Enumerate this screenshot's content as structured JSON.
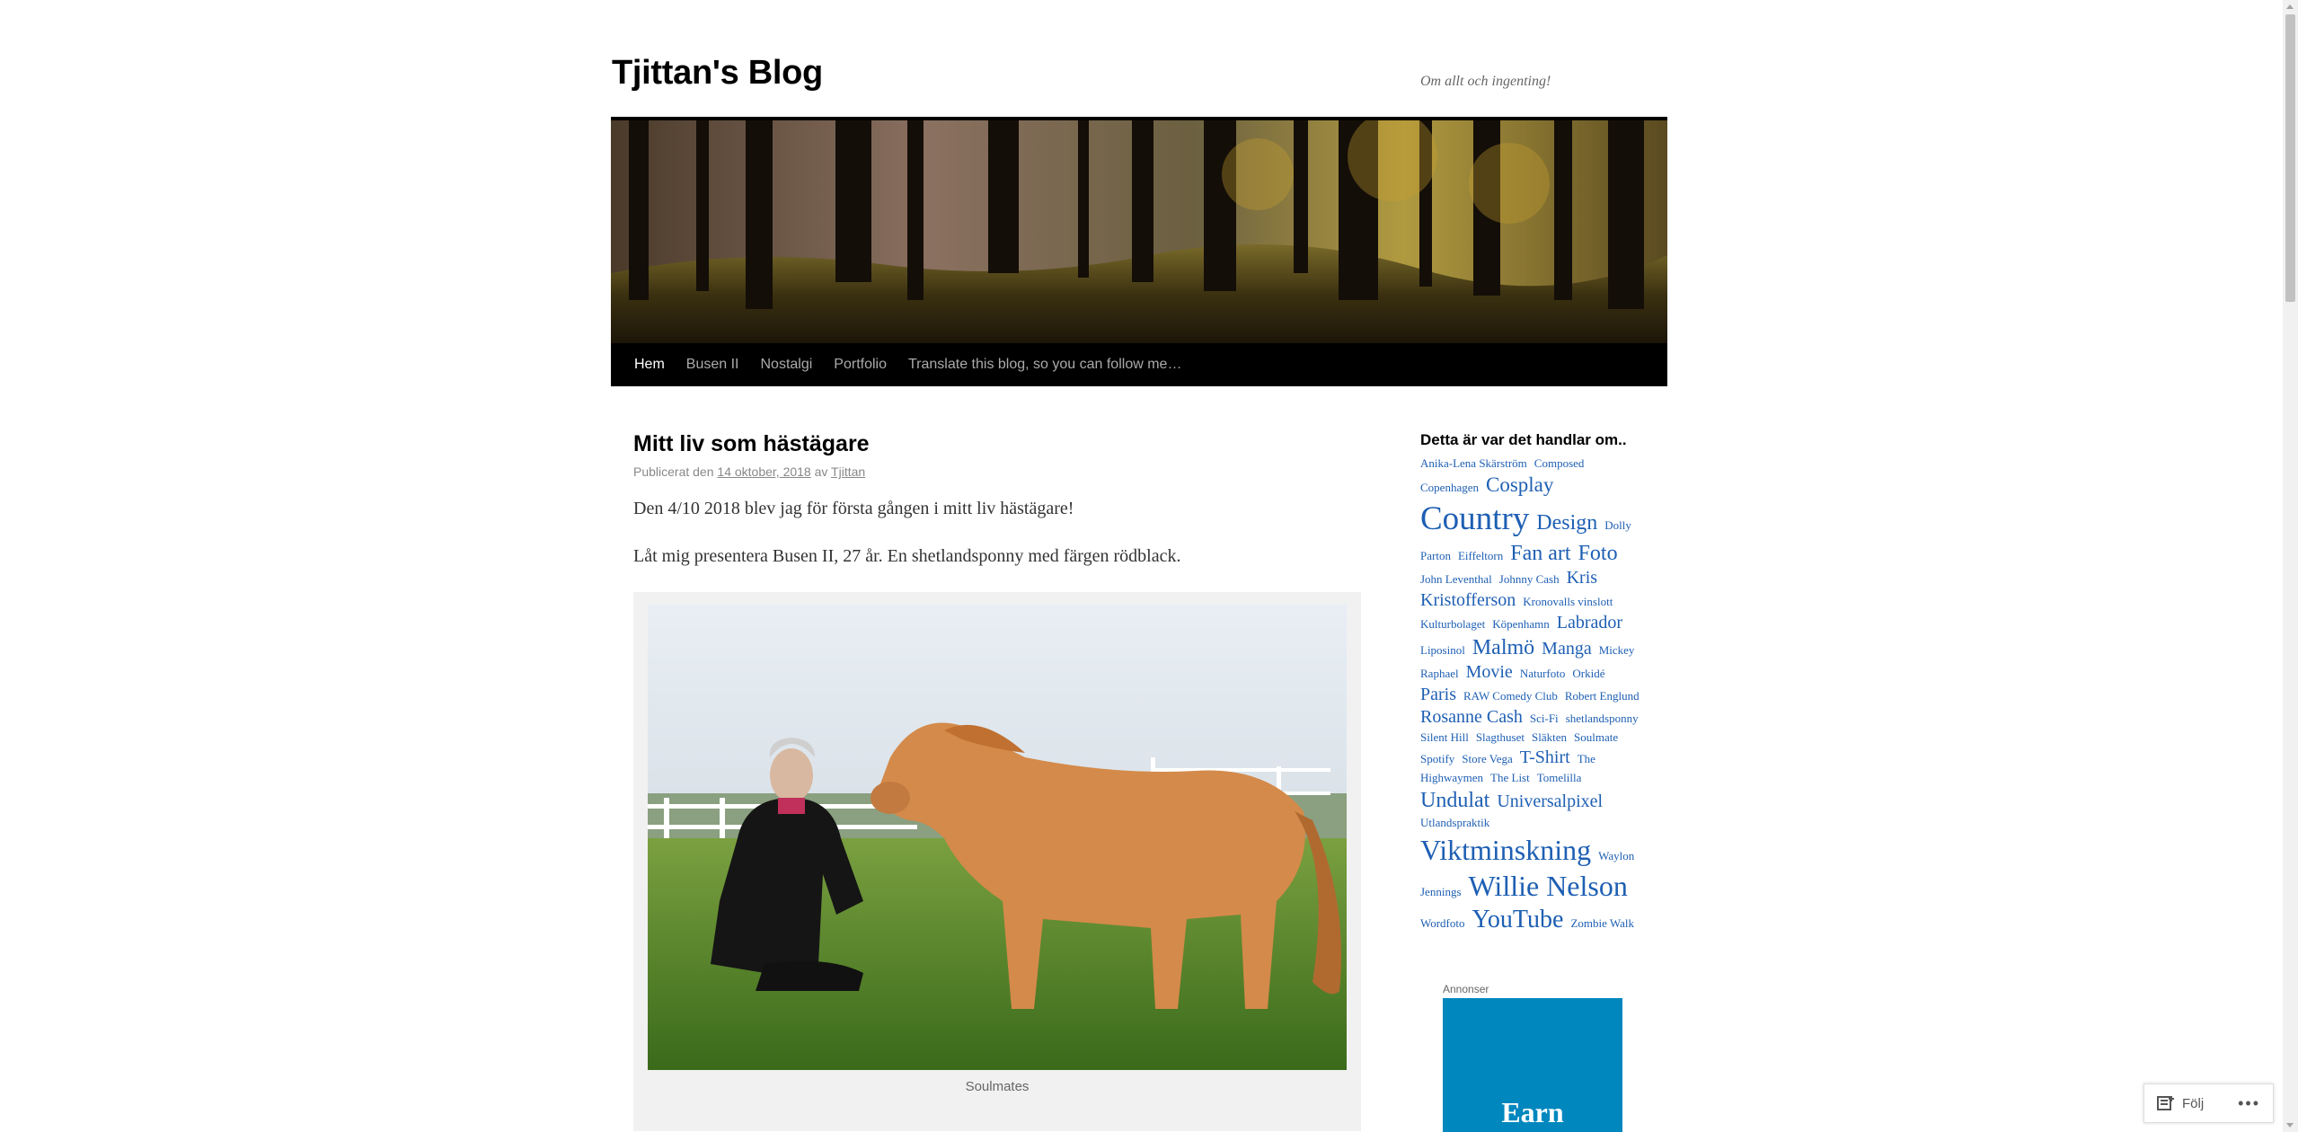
{
  "site": {
    "title": "Tjittan's Blog",
    "description": "Om allt och ingenting!"
  },
  "nav": {
    "items": [
      {
        "label": "Hem",
        "current": true
      },
      {
        "label": "Busen II"
      },
      {
        "label": "Nostalgi"
      },
      {
        "label": "Portfolio"
      },
      {
        "label": "Translate this blog, so you can follow me…"
      }
    ]
  },
  "post": {
    "title": "Mitt liv som hästägare",
    "meta_prefix": "Publicerat den",
    "date": "14 oktober, 2018",
    "meta_by": "av",
    "author": "Tjittan",
    "paragraphs": [
      "Den 4/10 2018 blev jag för första gången i mitt liv hästägare!",
      "Låt mig presentera Busen II, 27 år. En shetlandsponny med färgen rödblack."
    ],
    "image_caption": "Soulmates"
  },
  "sidebar": {
    "widget_title": "Detta är var det handlar om..",
    "tags": [
      {
        "label": "Anika-Lena Skärström",
        "size": 13
      },
      {
        "label": "Composed",
        "size": 13
      },
      {
        "label": "Copenhagen",
        "size": 13
      },
      {
        "label": "Cosplay",
        "size": 23
      },
      {
        "label": "Country",
        "size": 37
      },
      {
        "label": "Design",
        "size": 24
      },
      {
        "label": "Dolly Parton",
        "size": 13
      },
      {
        "label": "Eiffeltorn",
        "size": 13
      },
      {
        "label": "Fan art",
        "size": 24
      },
      {
        "label": "Foto",
        "size": 24
      },
      {
        "label": "John Leventhal",
        "size": 13
      },
      {
        "label": "Johnny Cash",
        "size": 13
      },
      {
        "label": "Kris Kristofferson",
        "size": 20
      },
      {
        "label": "Kronovalls vinslott",
        "size": 13
      },
      {
        "label": "Kulturbolaget",
        "size": 13
      },
      {
        "label": "Köpenhamn",
        "size": 13
      },
      {
        "label": "Labrador",
        "size": 20
      },
      {
        "label": "Liposinol",
        "size": 13
      },
      {
        "label": "Malmö",
        "size": 24
      },
      {
        "label": "Manga",
        "size": 20
      },
      {
        "label": "Mickey Raphael",
        "size": 13
      },
      {
        "label": "Movie",
        "size": 20
      },
      {
        "label": "Naturfoto",
        "size": 13
      },
      {
        "label": "Orkidé",
        "size": 13
      },
      {
        "label": "Paris",
        "size": 20
      },
      {
        "label": "RAW Comedy Club",
        "size": 13
      },
      {
        "label": "Robert Englund",
        "size": 13
      },
      {
        "label": "Rosanne Cash",
        "size": 20
      },
      {
        "label": "Sci-Fi",
        "size": 13
      },
      {
        "label": "shetlandsponny",
        "size": 13
      },
      {
        "label": "Silent Hill",
        "size": 13
      },
      {
        "label": "Slagthuset",
        "size": 13
      },
      {
        "label": "Släkten",
        "size": 13
      },
      {
        "label": "Soulmate",
        "size": 13
      },
      {
        "label": "Spotify",
        "size": 13
      },
      {
        "label": "Store Vega",
        "size": 13
      },
      {
        "label": "T-Shirt",
        "size": 20
      },
      {
        "label": "The Highwaymen",
        "size": 13
      },
      {
        "label": "The List",
        "size": 13
      },
      {
        "label": "Tomelilla",
        "size": 13
      },
      {
        "label": "Undulat",
        "size": 24
      },
      {
        "label": "Universalpixel",
        "size": 20
      },
      {
        "label": "Utlandspraktik",
        "size": 13
      },
      {
        "label": "Viktminskning",
        "size": 32
      },
      {
        "label": "Waylon Jennings",
        "size": 13
      },
      {
        "label": "Willie Nelson",
        "size": 32
      },
      {
        "label": "Wordfoto",
        "size": 13
      },
      {
        "label": "YouTube",
        "size": 28
      },
      {
        "label": "Zombie Walk",
        "size": 13
      }
    ],
    "ad_label": "Annonser",
    "ad_text": "Earn"
  },
  "follow_bar": {
    "follow_label": "Följ",
    "more_label": "•••"
  },
  "colors": {
    "link": "#1e5fb3",
    "nav_bg": "#000000",
    "ad_bg": "#0087be"
  }
}
